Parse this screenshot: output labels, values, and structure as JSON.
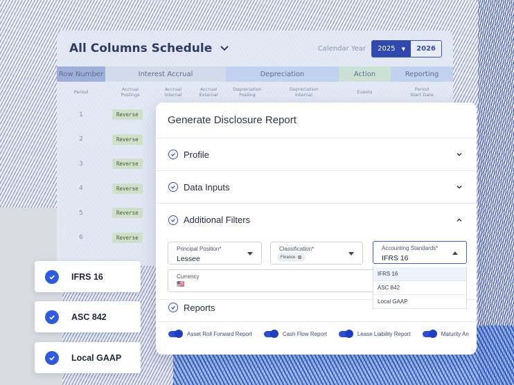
{
  "schedule": {
    "title": "All Columns Schedule",
    "calendar_label": "Calendar Year",
    "year_selected": "2025",
    "year_other": "2026",
    "columns": [
      {
        "label": "Row Number",
        "width": 70,
        "bg": "#9db0da"
      },
      {
        "label": "Interest Accrual",
        "width": 174,
        "bg": "#d1dbe9"
      },
      {
        "label": "Depreciation",
        "width": 163,
        "bg": "#c2d1ef"
      },
      {
        "label": "Action",
        "width": 75,
        "bg": "#cde0d6"
      },
      {
        "label": "Reporting",
        "width": 90,
        "bg": "#c2d1ef"
      }
    ],
    "subcolumns": [
      "Period",
      "Accrual\nPostings",
      "Accrual\nInternal",
      "Accrual\nExternal",
      "Depreciation\nPosting",
      "Depreciation\nInternal",
      "Events",
      "Period\nStart Date"
    ],
    "rows": [
      {
        "num": "1",
        "badge": "Reverse"
      },
      {
        "num": "2",
        "badge": "Reverse"
      },
      {
        "num": "3",
        "badge": "Reverse"
      },
      {
        "num": "4",
        "badge": "Reverse"
      },
      {
        "num": "5",
        "badge": "Reverse"
      },
      {
        "num": "6",
        "badge": "Reverse"
      }
    ]
  },
  "modal": {
    "title": "Generate Disclosure Report",
    "sections": {
      "profile": "Profile",
      "data_inputs": "Data Inputs",
      "additional_filters": "Additional Filters",
      "reports": "Reports"
    },
    "fields": {
      "principal_position": {
        "label": "Principal Position*",
        "value": "Lessee"
      },
      "classification": {
        "label": "Classification*",
        "chip": "Finance"
      },
      "accounting_standards": {
        "label": "Accounting Standards*",
        "value": "IFRS 16"
      },
      "currency": {
        "label": "Currency",
        "flag": "🇺🇸"
      }
    },
    "standards_options": [
      "IFRS 16",
      "ASC 842",
      "Local GAAP"
    ],
    "report_toggles": [
      "Asset Roll Forward Report",
      "Cash Flow Report",
      "Lease Liability Report",
      "Maturity An"
    ]
  },
  "side_cards": [
    "IFRS 16",
    "ASC 842",
    "Local GAAP"
  ],
  "colors": {
    "accent": "#2f4fd0",
    "badge_bg": "#cfe0c8"
  }
}
